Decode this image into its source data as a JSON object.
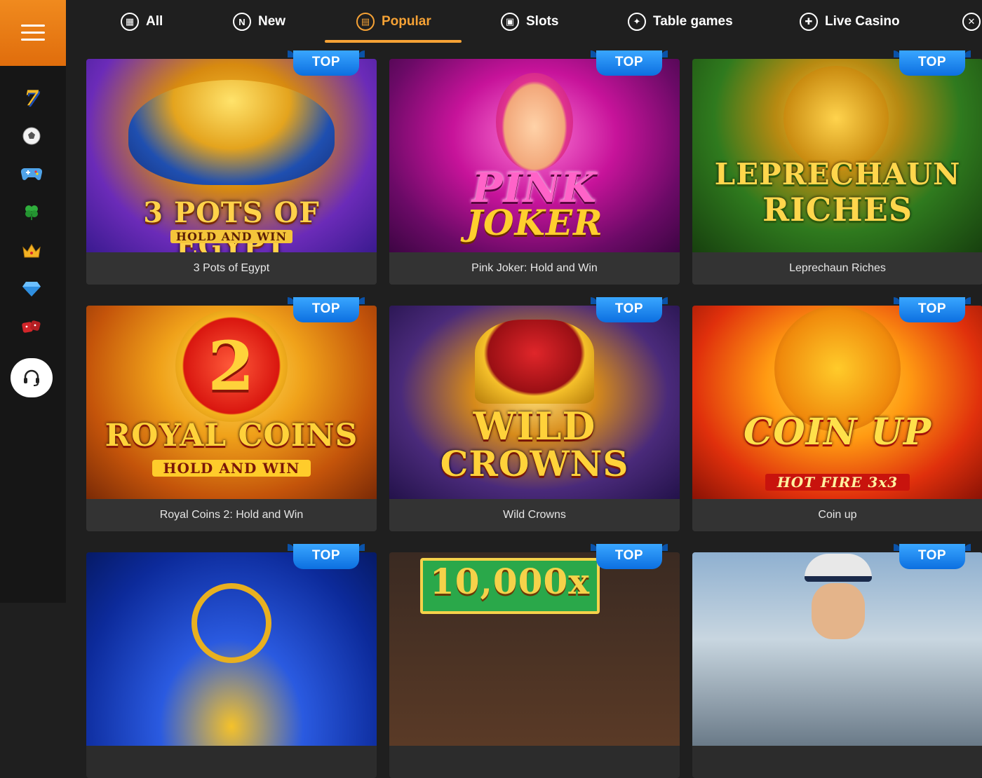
{
  "sidebar": {
    "menu_icon": "hamburger-icon",
    "items": [
      {
        "name": "sidebar-slots-seven",
        "icon": "seven-icon",
        "glyph": "7"
      },
      {
        "name": "sidebar-sports",
        "icon": "soccer-ball-icon",
        "glyph": "⚽"
      },
      {
        "name": "sidebar-esports",
        "icon": "gamepad-icon",
        "glyph": "🎮"
      },
      {
        "name": "sidebar-lucky",
        "icon": "clover-icon",
        "glyph": "☘"
      },
      {
        "name": "sidebar-vip",
        "icon": "crown-icon",
        "glyph": "♛"
      },
      {
        "name": "sidebar-diamond",
        "icon": "diamond-icon",
        "glyph": "◆"
      },
      {
        "name": "sidebar-dice",
        "icon": "dice-icon",
        "glyph": "⚄"
      }
    ],
    "support_icon": "headset-icon"
  },
  "nav": {
    "tabs": [
      {
        "label": "All",
        "glyph": "▦",
        "icon": "grid-icon"
      },
      {
        "label": "New",
        "glyph": "N",
        "icon": "new-icon"
      },
      {
        "label": "Popular",
        "glyph": "▤",
        "icon": "popular-icon",
        "active": true
      },
      {
        "label": "Slots",
        "glyph": "▣",
        "icon": "slot-machine-icon"
      },
      {
        "label": "Table games",
        "glyph": "✦",
        "icon": "poker-chip-icon"
      },
      {
        "label": "Live Casino",
        "glyph": "✚",
        "icon": "live-casino-icon"
      }
    ]
  },
  "games": [
    {
      "title": "3 Pots of Egypt",
      "badge": "TOP",
      "art_line1": "3 POTS OF EGYPT",
      "art_line2": "HOLD AND WIN"
    },
    {
      "title": "Pink Joker: Hold and Win",
      "badge": "TOP",
      "art_line1": "PINK",
      "art_line2": "JOKER"
    },
    {
      "title": "Leprechaun Riches",
      "badge": "TOP",
      "art_line1": "LEPRECHAUN",
      "art_line2": "RICHES"
    },
    {
      "title": "Royal Coins 2: Hold and Win",
      "badge": "TOP",
      "art_line1": "ROYAL COINS",
      "art_line2": "HOLD AND WIN"
    },
    {
      "title": "Wild Crowns",
      "badge": "TOP",
      "art_line1": "WILD",
      "art_line2": "CROWNS"
    },
    {
      "title": "Coin up",
      "badge": "TOP",
      "art_line1": "COIN UP",
      "art_line2": "HOT FIRE 3x3"
    },
    {
      "badge": "TOP"
    },
    {
      "badge": "TOP",
      "art_line1": "10,000x"
    },
    {
      "badge": "TOP"
    }
  ],
  "colors": {
    "accent": "#f6a235",
    "menu_bg": "#e8770f",
    "badge": "#1b8af0",
    "card_caption": "#333333",
    "page_bg": "#1f1f1f"
  }
}
